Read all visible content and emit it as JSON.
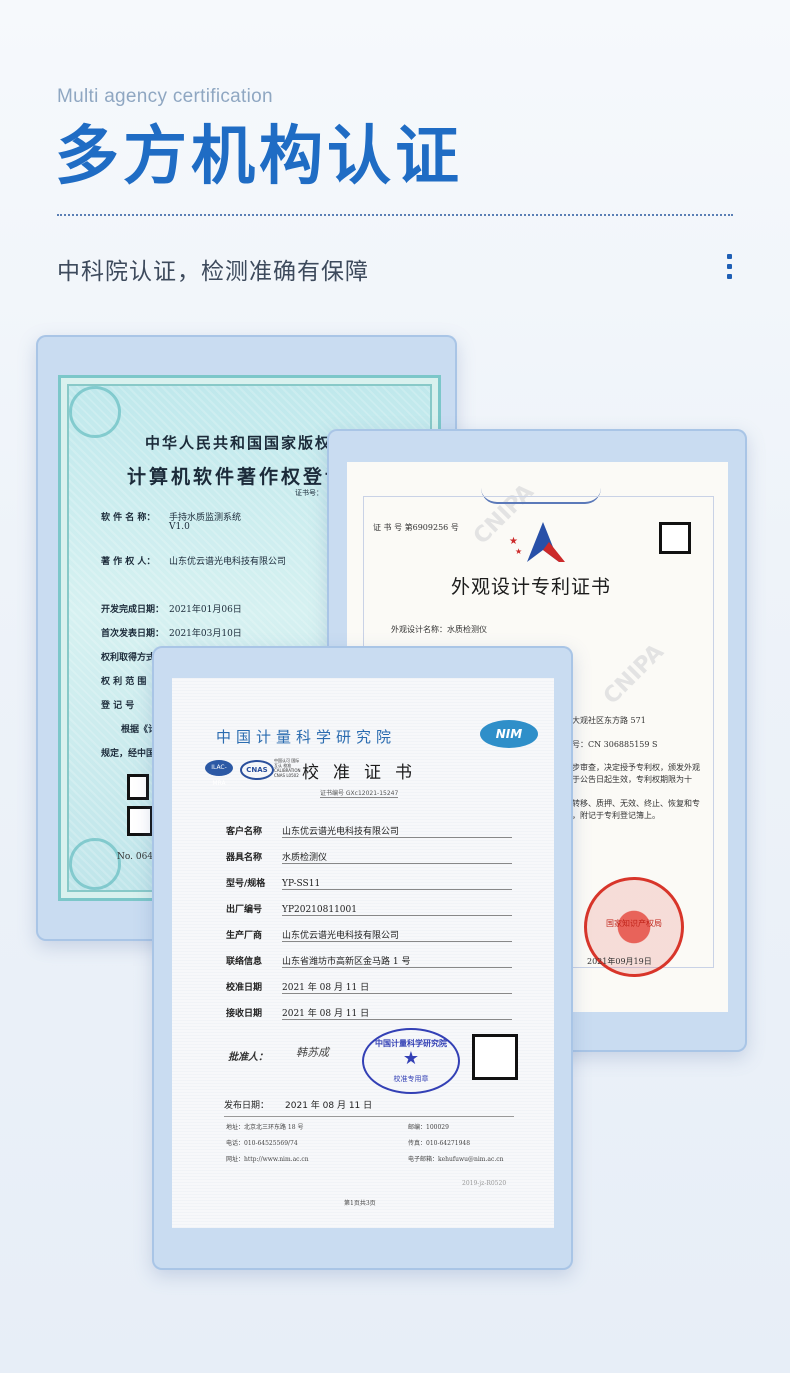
{
  "header": {
    "subtitle_en": "Multi agency certification",
    "title_cn": "多方机构认证",
    "description": "中科院认证，检测准确有保障"
  },
  "colors": {
    "accent": "#1f6cc4",
    "subtitle": "#8fa7c2",
    "frame": "#c9dcf1"
  },
  "software_cert": {
    "title1": "中华人民共和国国家版权",
    "title2": "计算机软件著作权登记",
    "cert_no_label": "证书号：",
    "rows": [
      {
        "k": "软 件 名 称：",
        "v": "手持水质监测系统"
      },
      {
        "k": "",
        "v": "V1.0"
      },
      {
        "k": "著 作 权 人：",
        "v": "山东优云谱光电科技有限公司"
      },
      {
        "k": "开发完成日期：",
        "v": "2021年01月06日"
      },
      {
        "k": "首次发表日期：",
        "v": "2021年03月10日"
      },
      {
        "k": "权利取得方式",
        "v": ""
      },
      {
        "k": "权 利 范 围",
        "v": ""
      },
      {
        "k": "登  记  号",
        "v": ""
      },
      {
        "k": "根据《计",
        "v": ""
      },
      {
        "k": "规定，经中国",
        "v": ""
      }
    ],
    "number": "No. 0641"
  },
  "patent_cert": {
    "cert_no": "证 书 号 第6909256 号",
    "title": "外观设计专利证书",
    "design_name": "外观设计名称：水质检测仪",
    "watermark": "CNIPA",
    "lines": [
      "大观社区东方路 571",
      "号：CN 306885159 S",
      "步审查，决定授予专利权，颁发外观",
      "于公告日起生效，专利权期限为十",
      "转移、质押、无效、终止、恢复和专",
      "，附记于专利登记簿上。"
    ],
    "seal_text": "国家知识产权局",
    "date": "2021年09月19日"
  },
  "calibration_cert": {
    "org": "中国计量科学研究院",
    "nim_logo": "NIM",
    "ilac": "ILAC-MRA",
    "cnas": "CNAS",
    "cnas_sub": "中国认可 国际互认 校准 CALIBRATION CNAS L0502",
    "title": "校准证书",
    "cert_no": "证书编号 GXc12021-15247",
    "rows": [
      {
        "k": "客户名称",
        "v": "山东优云谱光电科技有限公司"
      },
      {
        "k": "器具名称",
        "v": "水质检测仪"
      },
      {
        "k": "型号/规格",
        "v": "YP-SS11"
      },
      {
        "k": "出厂编号",
        "v": "YP20210811001"
      },
      {
        "k": "生产厂商",
        "v": "山东优云谱光电科技有限公司"
      },
      {
        "k": "联络信息",
        "v": "山东省潍坊市高新区金马路 1 号"
      },
      {
        "k": "校准日期",
        "v": "2021 年  08 月  11 日"
      },
      {
        "k": "接收日期",
        "v": "2021 年  08 月  11 日"
      }
    ],
    "approver_label": "批准人：",
    "signature": "韩苏成",
    "seal_top": "中国计量科学研究院",
    "seal_bottom": "校准专用章",
    "issue_label": "发布日期：",
    "issue_date": "2021 年  08 月  11 日",
    "footer": {
      "address": "地址：北京北三环东路 18 号",
      "postcode": "邮编：100029",
      "phone": "电话：010-64525569/74",
      "fax": "传真：010-64271948",
      "website": "网址：http://www.nim.ac.cn",
      "email": "电子邮箱：kehufuwu@nim.ac.cn",
      "code": "2019-jz-R0520",
      "page": "第1页共3页"
    }
  }
}
